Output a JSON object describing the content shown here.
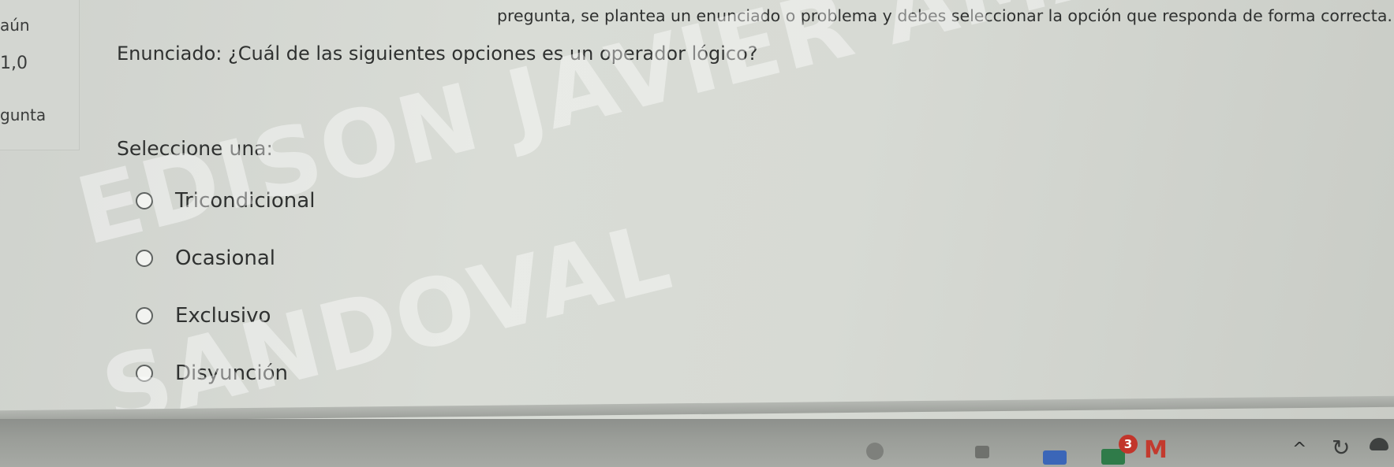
{
  "sidebar": {
    "status": "aún",
    "grade": "1,0",
    "mark_label": "gunta"
  },
  "question": {
    "instructions": "pregunta, se plantea un enunciado o problema y debes seleccionar la opción que responda de forma correcta.",
    "prompt": "Enunciado: ¿Cuál de las siguientes opciones es un operador lógico?",
    "select_label": "Seleccione una:",
    "options": [
      {
        "label": "Tricondicional"
      },
      {
        "label": "Ocasional"
      },
      {
        "label": "Exclusivo"
      },
      {
        "label": "Disyunción"
      }
    ]
  },
  "watermark": {
    "line1": "EDISON JAVIER AMADO",
    "line2": "SANDOVAL"
  },
  "taskbar": {
    "notification_count": "3",
    "mail_glyph": "M",
    "chevron_glyph": "^"
  }
}
